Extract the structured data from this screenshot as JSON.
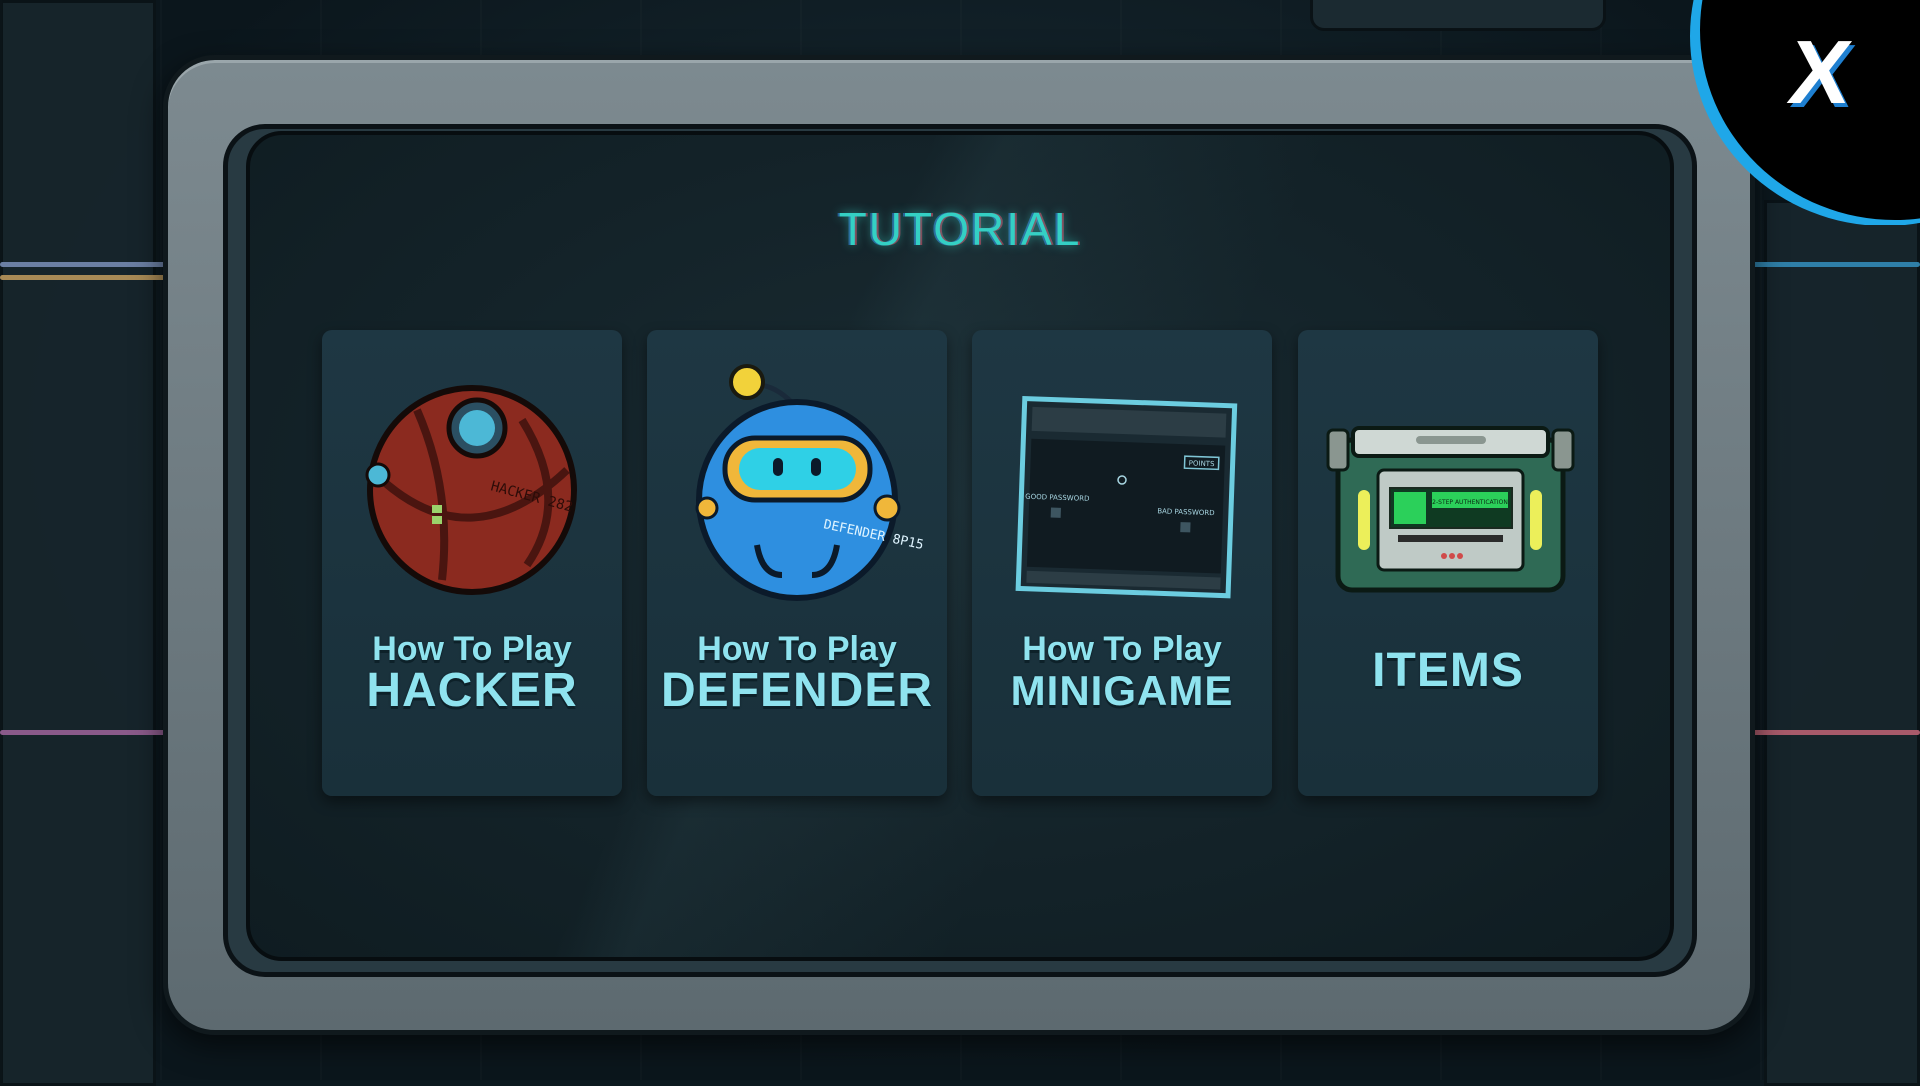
{
  "screen": {
    "title": "TUTORIAL"
  },
  "cards": [
    {
      "line1": "How To Play",
      "line2": "HACKER",
      "art": "hacker-robot-ball-icon",
      "art_text": "HACKER 282"
    },
    {
      "line1": "How To Play",
      "line2": "DEFENDER",
      "art": "defender-robot-ball-icon",
      "art_text": "DEFENDER 8P15"
    },
    {
      "line1": "How To Play",
      "line2": "MINIGAME",
      "art": "minigame-console-icon",
      "art_labels": [
        "POINTS",
        "GOOD PASSWORD",
        "BAD PASSWORD"
      ]
    },
    {
      "line1": "",
      "line2": "ITEMS",
      "art": "item-crate-icon",
      "art_labels": [
        "2-STEP AUTHENTICATION"
      ]
    }
  ],
  "close": {
    "label": "X",
    "icon": "close-icon"
  },
  "colors": {
    "accent": "#34d0c4",
    "card_text": "#8fe3ef",
    "close_ring": "#1fa7e8"
  }
}
